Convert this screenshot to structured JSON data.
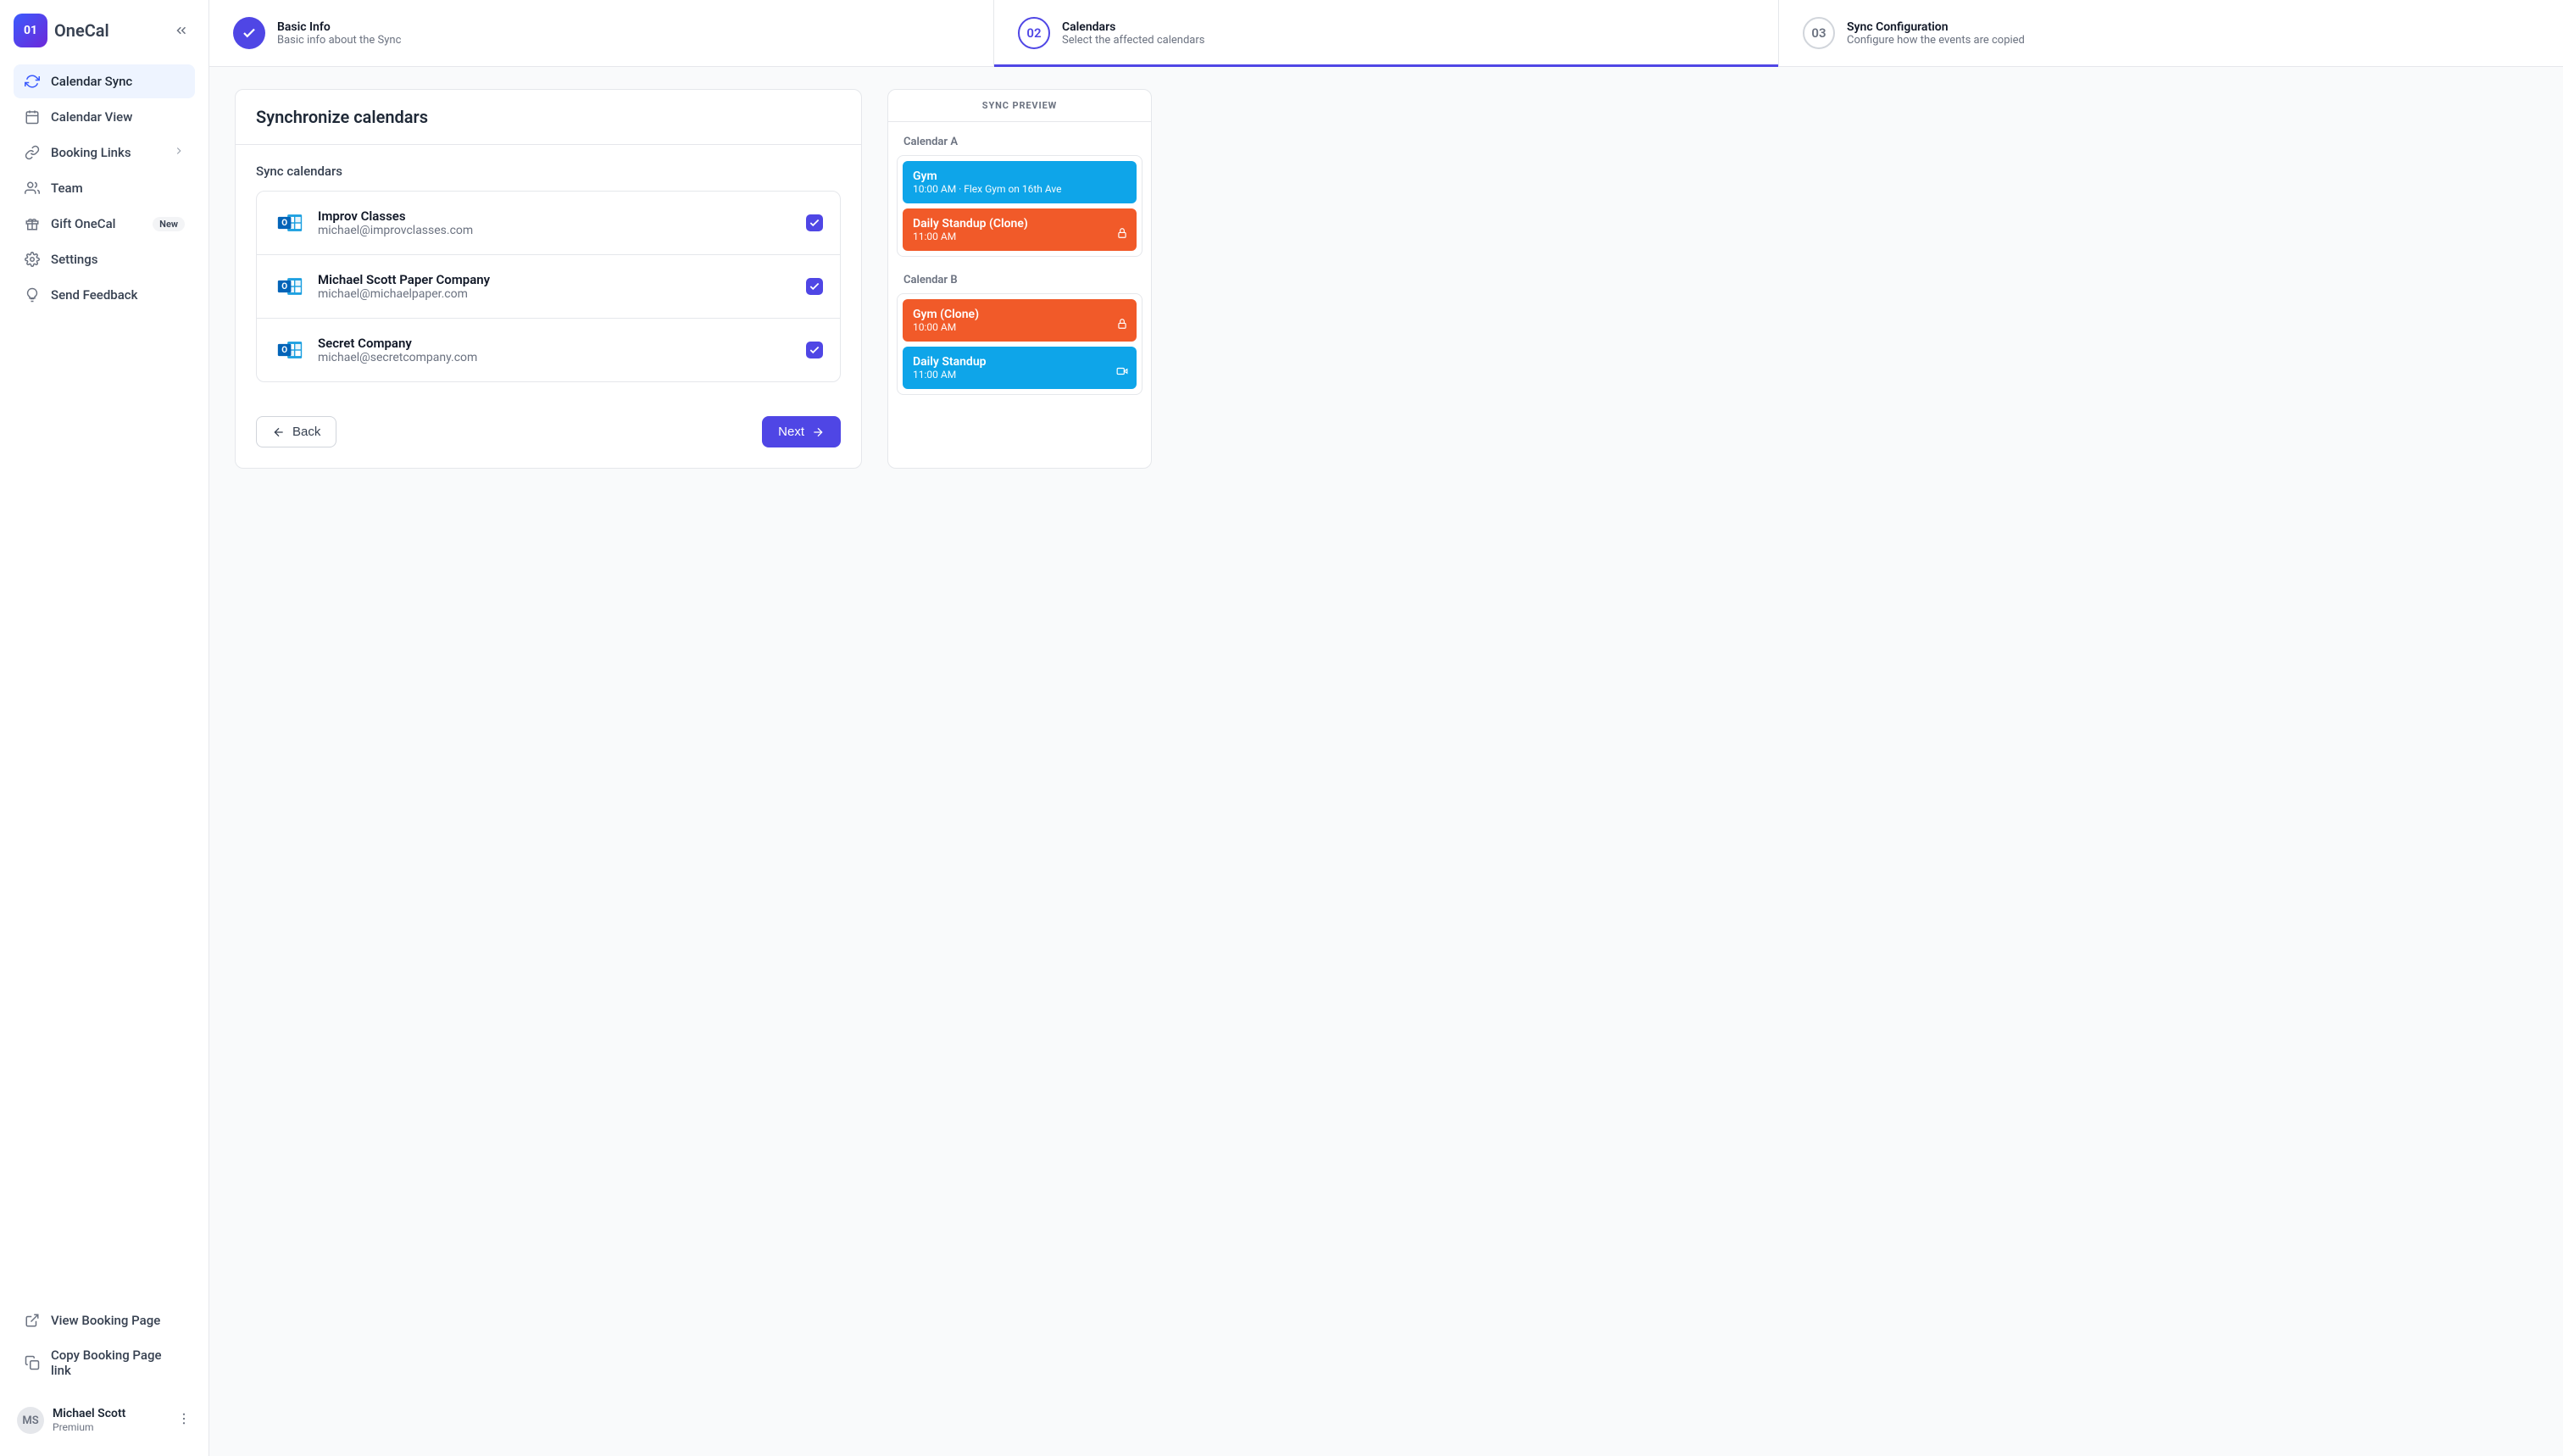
{
  "brand": {
    "mark": "01",
    "name": "OneCal"
  },
  "nav": {
    "calendar_sync": "Calendar Sync",
    "calendar_view": "Calendar View",
    "booking_links": "Booking Links",
    "team": "Team",
    "gift_onecal": "Gift OneCal",
    "gift_badge": "New",
    "settings": "Settings",
    "send_feedback": "Send Feedback",
    "view_booking_page": "View Booking Page",
    "copy_booking_link": "Copy Booking Page link"
  },
  "user": {
    "name": "Michael Scott",
    "plan": "Premium",
    "initials": "MS"
  },
  "stepper": {
    "step1": {
      "title": "Basic Info",
      "sub": "Basic info about the Sync"
    },
    "step2": {
      "num": "02",
      "title": "Calendars",
      "sub": "Select the affected calendars"
    },
    "step3": {
      "num": "03",
      "title": "Sync Configuration",
      "sub": "Configure how the events are copied"
    }
  },
  "page": {
    "title": "Synchronize calendars",
    "section_title": "Sync calendars",
    "back": "Back",
    "next": "Next"
  },
  "calendars": [
    {
      "name": "Improv Classes",
      "email": "michael@improvclasses.com"
    },
    {
      "name": "Michael Scott Paper Company",
      "email": "michael@michaelpaper.com"
    },
    {
      "name": "Secret Company",
      "email": "michael@secretcompany.com"
    }
  ],
  "preview": {
    "heading": "SYNC PREVIEW",
    "cal_a": "Calendar A",
    "cal_b": "Calendar B",
    "events_a": [
      {
        "title": "Gym",
        "time": "10:00 AM · Flex Gym on 16th Ave",
        "color": "blue"
      },
      {
        "title": "Daily Standup (Clone)",
        "time": "11:00 AM",
        "color": "orange",
        "icon": "lock"
      }
    ],
    "events_b": [
      {
        "title": "Gym (Clone)",
        "time": "10:00 AM",
        "color": "orange",
        "icon": "lock"
      },
      {
        "title": "Daily Standup",
        "time": "11:00 AM",
        "color": "blue",
        "icon": "video"
      }
    ]
  }
}
